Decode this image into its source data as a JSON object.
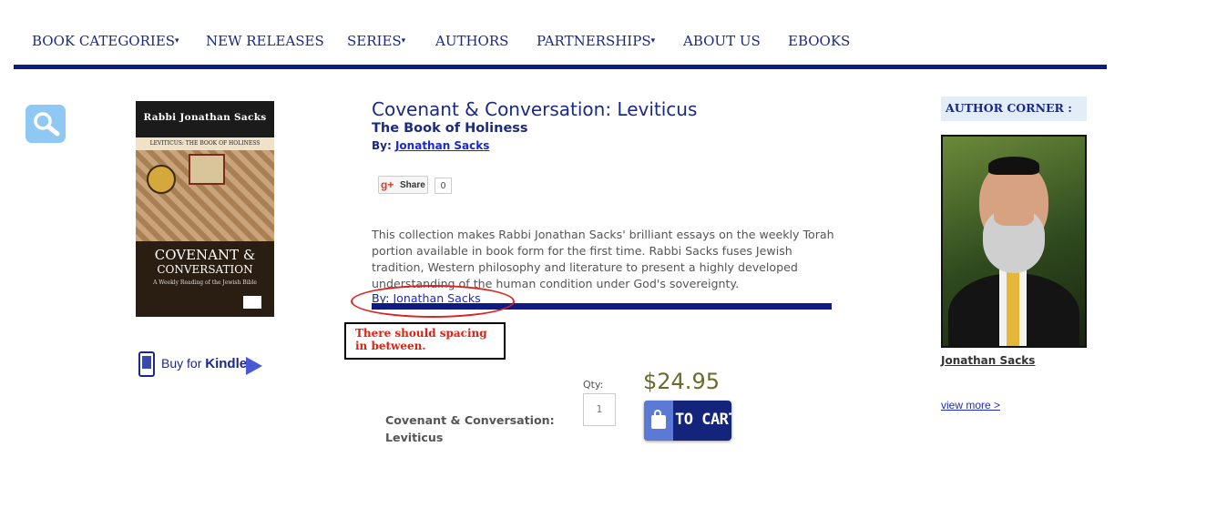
{
  "nav": {
    "items": [
      {
        "label": "BOOK CATEGORIES",
        "dropdown": true
      },
      {
        "label": "NEW RELEASES",
        "dropdown": false
      },
      {
        "label": "SERIES",
        "dropdown": true
      },
      {
        "label": "AUTHORS",
        "dropdown": false
      },
      {
        "label": "PARTNERSHIPS",
        "dropdown": true
      },
      {
        "label": "ABOUT US",
        "dropdown": false
      },
      {
        "label": "EBOOKS",
        "dropdown": false
      }
    ],
    "caret": "▾",
    "bar_color": "#0d1b82"
  },
  "search": {
    "icon": "search-icon"
  },
  "cover": {
    "author": "Rabbi Jonathan Sacks",
    "series_line": "LEVITICUS: THE BOOK OF HOLINESS",
    "title_line1": "COVENANT &",
    "title_line2": "CONVERSATION",
    "tagline": "A Weekly Reading of the Jewish Bible"
  },
  "kindle": {
    "prefix": "Buy for",
    "brand": "Kindle",
    "icon": "kindle-icon",
    "arrow": "play-arrow-icon"
  },
  "product": {
    "title": "Covenant & Conversation: Leviticus",
    "subtitle": "The Book of Holiness",
    "by_label": "By:",
    "author": "Jonathan Sacks",
    "description": "This collection makes Rabbi Jonathan Sacks' brilliant essays on the weekly Torah portion available in book form for the first time. Rabbi Sacks fuses Jewish tradition, Western philosophy and literature to present a highly developed understanding of the human condition under God's sovereignty.",
    "desc_by_label": "By:",
    "desc_author": "Jonathan Sacks"
  },
  "share": {
    "icon": "google-plus-icon",
    "plus": "g+",
    "label": "Share",
    "count": "0"
  },
  "annotation": {
    "note": "There should spacing in between.",
    "color": "#dd2222"
  },
  "purchase": {
    "qty_label": "Qty:",
    "qty_value": "1",
    "price": "$24.95",
    "cart_label": "TO CART",
    "cart_icon": "shopping-bag-icon",
    "item_name": "Covenant & Conversation: Leviticus"
  },
  "author_corner": {
    "heading": "AUTHOR CORNER :",
    "name": "Jonathan Sacks",
    "view_more": "view more >"
  }
}
